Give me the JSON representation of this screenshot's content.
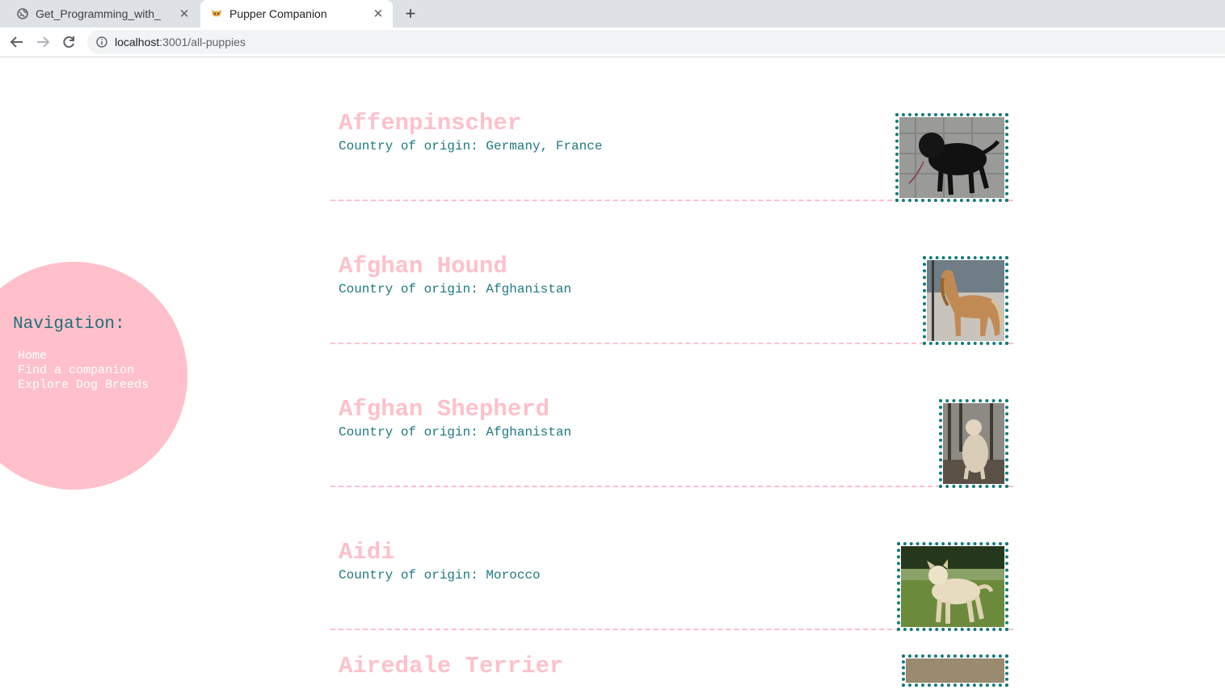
{
  "browser": {
    "tabs": [
      {
        "title": "Get_Programming_with_",
        "icon": "globe-icon",
        "active": false
      },
      {
        "title": "Pupper Companion",
        "icon": "dog-favicon",
        "active": true
      }
    ],
    "url_host": "localhost",
    "url_path": ":3001/all-puppies"
  },
  "navigation": {
    "heading": "Navigation:",
    "links": [
      "Home",
      "Find a companion",
      "Explore Dog Breeds"
    ]
  },
  "breeds": [
    {
      "name": "Affenpinscher",
      "origin": "Country of origin: Germany, France",
      "photo": "black-dog-photo"
    },
    {
      "name": "Afghan Hound",
      "origin": "Country of origin: Afghanistan",
      "photo": "afghan-hound-photo"
    },
    {
      "name": "Afghan Shepherd",
      "origin": "Country of origin: Afghanistan",
      "photo": "afghan-shepherd-photo"
    },
    {
      "name": "Aidi",
      "origin": "Country of origin: Morocco",
      "photo": "aidi-photo"
    },
    {
      "name": "Airedale Terrier",
      "origin": "",
      "photo": "airedale-photo"
    }
  ],
  "colors": {
    "accent_pink": "#ffc0cb",
    "teal": "#1f7a80"
  }
}
